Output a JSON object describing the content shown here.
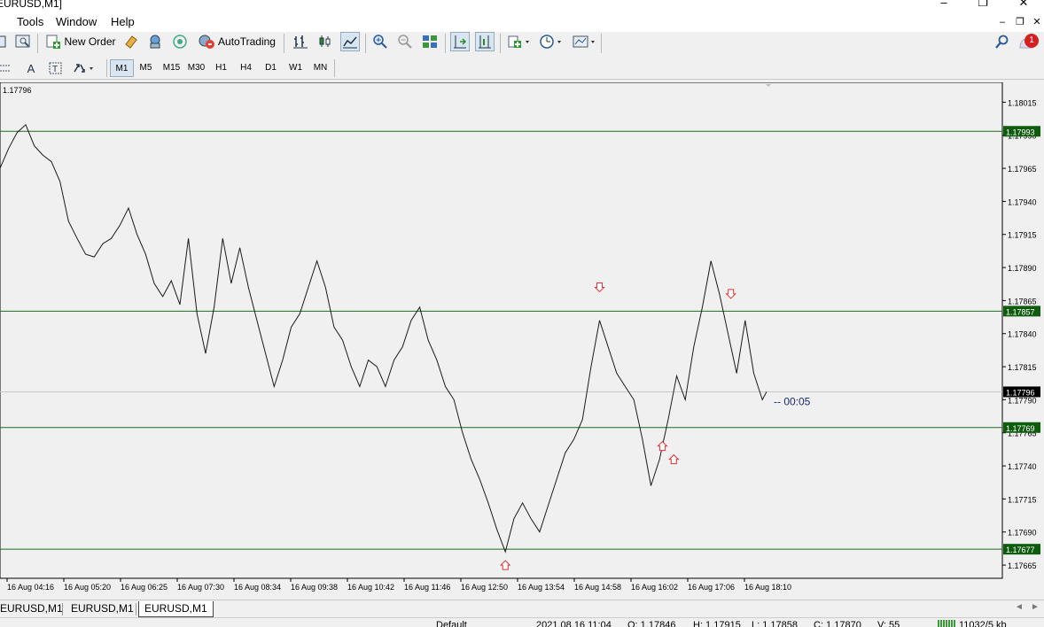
{
  "window": {
    "title": "EURUSD,M1]"
  },
  "menu": {
    "items": [
      "Tools",
      "Window",
      "Help"
    ]
  },
  "toolbar": {
    "new_order": "New Order",
    "auto_trading": "AutoTrading",
    "notification_count": "1"
  },
  "timeframes": [
    "M1",
    "M5",
    "M15",
    "M30",
    "H1",
    "H4",
    "D1",
    "W1",
    "MN"
  ],
  "active_timeframe": "M1",
  "chart": {
    "top_left_price": "1.17796",
    "countdown": "00:05",
    "countdown_prefix": "--"
  },
  "chart_data": {
    "type": "line",
    "symbol": "EURUSD",
    "timeframe": "M1",
    "y_ticks": [
      "1.18015",
      "1.17990",
      "1.17965",
      "1.17940",
      "1.17915",
      "1.17890",
      "1.17865",
      "1.17840",
      "1.17815",
      "1.17790",
      "1.17765",
      "1.17740",
      "1.17715",
      "1.17690",
      "1.17665"
    ],
    "x_ticks": [
      "16 Aug 04:16",
      "16 Aug 05:20",
      "16 Aug 06:25",
      "16 Aug 07:30",
      "16 Aug 08:34",
      "16 Aug 09:38",
      "16 Aug 10:42",
      "16 Aug 11:46",
      "16 Aug 12:50",
      "16 Aug 13:54",
      "16 Aug 14:58",
      "16 Aug 16:02",
      "16 Aug 17:06",
      "16 Aug 18:10"
    ],
    "y_range": [
      1.17655,
      1.1803
    ],
    "horizontal_lines": [
      {
        "label": "1.17993",
        "value": 1.17993
      },
      {
        "label": "1.17857",
        "value": 1.17857
      },
      {
        "label": "1.17769",
        "value": 1.17769
      },
      {
        "label": "1.17677",
        "value": 1.17677
      }
    ],
    "current_price": {
      "label": "1.17796",
      "value": 1.17796
    },
    "price_series": [
      {
        "x": 0,
        "y": 1.17965
      },
      {
        "x": 0.3,
        "y": 1.1798
      },
      {
        "x": 0.6,
        "y": 1.17992
      },
      {
        "x": 0.9,
        "y": 1.17998
      },
      {
        "x": 1.2,
        "y": 1.17982
      },
      {
        "x": 1.5,
        "y": 1.17975
      },
      {
        "x": 1.8,
        "y": 1.1797
      },
      {
        "x": 2.1,
        "y": 1.17955
      },
      {
        "x": 2.4,
        "y": 1.17925
      },
      {
        "x": 2.7,
        "y": 1.17912
      },
      {
        "x": 3.0,
        "y": 1.179
      },
      {
        "x": 3.3,
        "y": 1.17898
      },
      {
        "x": 3.6,
        "y": 1.17908
      },
      {
        "x": 3.9,
        "y": 1.17912
      },
      {
        "x": 4.2,
        "y": 1.17922
      },
      {
        "x": 4.5,
        "y": 1.17935
      },
      {
        "x": 4.8,
        "y": 1.17915
      },
      {
        "x": 5.1,
        "y": 1.179
      },
      {
        "x": 5.4,
        "y": 1.17878
      },
      {
        "x": 5.7,
        "y": 1.17868
      },
      {
        "x": 6.0,
        "y": 1.1788
      },
      {
        "x": 6.3,
        "y": 1.17862
      },
      {
        "x": 6.6,
        "y": 1.17912
      },
      {
        "x": 6.9,
        "y": 1.17855
      },
      {
        "x": 7.2,
        "y": 1.17825
      },
      {
        "x": 7.5,
        "y": 1.1786
      },
      {
        "x": 7.8,
        "y": 1.17912
      },
      {
        "x": 8.1,
        "y": 1.17878
      },
      {
        "x": 8.4,
        "y": 1.17905
      },
      {
        "x": 8.7,
        "y": 1.17875
      },
      {
        "x": 9.0,
        "y": 1.1785
      },
      {
        "x": 9.3,
        "y": 1.17825
      },
      {
        "x": 9.6,
        "y": 1.178
      },
      {
        "x": 9.9,
        "y": 1.1782
      },
      {
        "x": 10.2,
        "y": 1.17845
      },
      {
        "x": 10.5,
        "y": 1.17855
      },
      {
        "x": 10.8,
        "y": 1.17875
      },
      {
        "x": 11.1,
        "y": 1.17895
      },
      {
        "x": 11.4,
        "y": 1.17875
      },
      {
        "x": 11.7,
        "y": 1.17845
      },
      {
        "x": 12.0,
        "y": 1.17835
      },
      {
        "x": 12.3,
        "y": 1.17815
      },
      {
        "x": 12.6,
        "y": 1.178
      },
      {
        "x": 12.9,
        "y": 1.1782
      },
      {
        "x": 13.2,
        "y": 1.17815
      },
      {
        "x": 13.5,
        "y": 1.178
      },
      {
        "x": 13.8,
        "y": 1.1782
      },
      {
        "x": 14.1,
        "y": 1.1783
      },
      {
        "x": 14.4,
        "y": 1.1785
      },
      {
        "x": 14.7,
        "y": 1.1786
      },
      {
        "x": 15.0,
        "y": 1.17835
      },
      {
        "x": 15.3,
        "y": 1.1782
      },
      {
        "x": 15.6,
        "y": 1.178
      },
      {
        "x": 15.9,
        "y": 1.1779
      },
      {
        "x": 16.2,
        "y": 1.17765
      },
      {
        "x": 16.5,
        "y": 1.17745
      },
      {
        "x": 16.8,
        "y": 1.1773
      },
      {
        "x": 17.1,
        "y": 1.17712
      },
      {
        "x": 17.4,
        "y": 1.17692
      },
      {
        "x": 17.7,
        "y": 1.17675
      },
      {
        "x": 18.0,
        "y": 1.177
      },
      {
        "x": 18.3,
        "y": 1.17712
      },
      {
        "x": 18.6,
        "y": 1.177
      },
      {
        "x": 18.9,
        "y": 1.1769
      },
      {
        "x": 19.2,
        "y": 1.1771
      },
      {
        "x": 19.5,
        "y": 1.1773
      },
      {
        "x": 19.8,
        "y": 1.1775
      },
      {
        "x": 20.1,
        "y": 1.1776
      },
      {
        "x": 20.4,
        "y": 1.17775
      },
      {
        "x": 20.7,
        "y": 1.17815
      },
      {
        "x": 21.0,
        "y": 1.1785
      },
      {
        "x": 21.3,
        "y": 1.1783
      },
      {
        "x": 21.6,
        "y": 1.1781
      },
      {
        "x": 21.9,
        "y": 1.178
      },
      {
        "x": 22.2,
        "y": 1.1779
      },
      {
        "x": 22.5,
        "y": 1.1776
      },
      {
        "x": 22.8,
        "y": 1.17725
      },
      {
        "x": 23.1,
        "y": 1.17745
      },
      {
        "x": 23.4,
        "y": 1.17775
      },
      {
        "x": 23.7,
        "y": 1.17808
      },
      {
        "x": 24.0,
        "y": 1.1779
      },
      {
        "x": 24.3,
        "y": 1.1783
      },
      {
        "x": 24.6,
        "y": 1.1786
      },
      {
        "x": 24.9,
        "y": 1.17895
      },
      {
        "x": 25.2,
        "y": 1.1787
      },
      {
        "x": 25.5,
        "y": 1.1784
      },
      {
        "x": 25.8,
        "y": 1.1781
      },
      {
        "x": 26.1,
        "y": 1.1785
      },
      {
        "x": 26.4,
        "y": 1.1781
      },
      {
        "x": 26.7,
        "y": 1.1779
      },
      {
        "x": 26.85,
        "y": 1.17796
      }
    ],
    "sell_arrows": [
      {
        "x": 21.0,
        "y": 1.17875
      },
      {
        "x": 25.6,
        "y": 1.1787
      }
    ],
    "buy_arrows": [
      {
        "x": 17.7,
        "y": 1.17665
      },
      {
        "x": 23.2,
        "y": 1.17755
      },
      {
        "x": 23.6,
        "y": 1.17745
      }
    ]
  },
  "tabs": [
    "EURUSD,M1",
    "EURUSD,M1",
    "EURUSD,M1"
  ],
  "active_tab": 2,
  "statusbar": {
    "profile": "Default",
    "datetime": "2021.08.16 11:04",
    "open": "O: 1.17846",
    "high": "H: 1.17915",
    "low": "L: 1.17858",
    "close": "C: 1.17870",
    "volume": "V: 55",
    "traffic": "11032/5 kb"
  },
  "colors": {
    "chart_bg": "#f0f0f0",
    "price_line": "#1a1a1a",
    "hline": "#1e6b1e",
    "hline_label_bg": "#0f5c0f",
    "current_label_bg": "#000000",
    "arrow": "#e03030",
    "countdown": "#1a2a80"
  }
}
